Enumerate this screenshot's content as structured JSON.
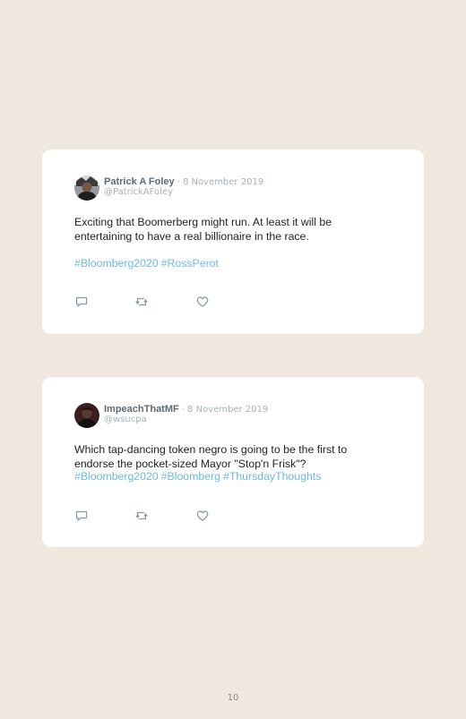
{
  "tweets": [
    {
      "name": "Patrick A Foley",
      "separator": "·",
      "date": "8 November 2019",
      "handle": "@PatrickAFoley",
      "text": "Exciting that Boomerberg might run. At least it will be entertaining to have a real billionaire in the race.",
      "hashtags": [
        "#Bloomberg2020",
        "#RossPerot"
      ],
      "avatar_icon": "user-avatar-photo"
    },
    {
      "name": "ImpeachThatMF",
      "separator": "·",
      "date": "8 November 2019",
      "handle": "@wsucpa",
      "text": "Which tap-dancing token negro is going to be the first to endorse the pocket-sized Mayor \"Stop'n Frisk\"?",
      "hashtags": [
        "#Bloomberg2020",
        "#Bloomberg",
        "#ThursdayThoughts"
      ],
      "avatar_icon": "user-avatar-photo"
    }
  ],
  "actions": [
    "reply-icon",
    "retweet-icon",
    "like-icon"
  ],
  "colors": {
    "background": "#f0e8de",
    "card": "#ffffff",
    "hashtag": "#6fb8e1",
    "meta": "#a8b0b6"
  },
  "page_number": "10"
}
